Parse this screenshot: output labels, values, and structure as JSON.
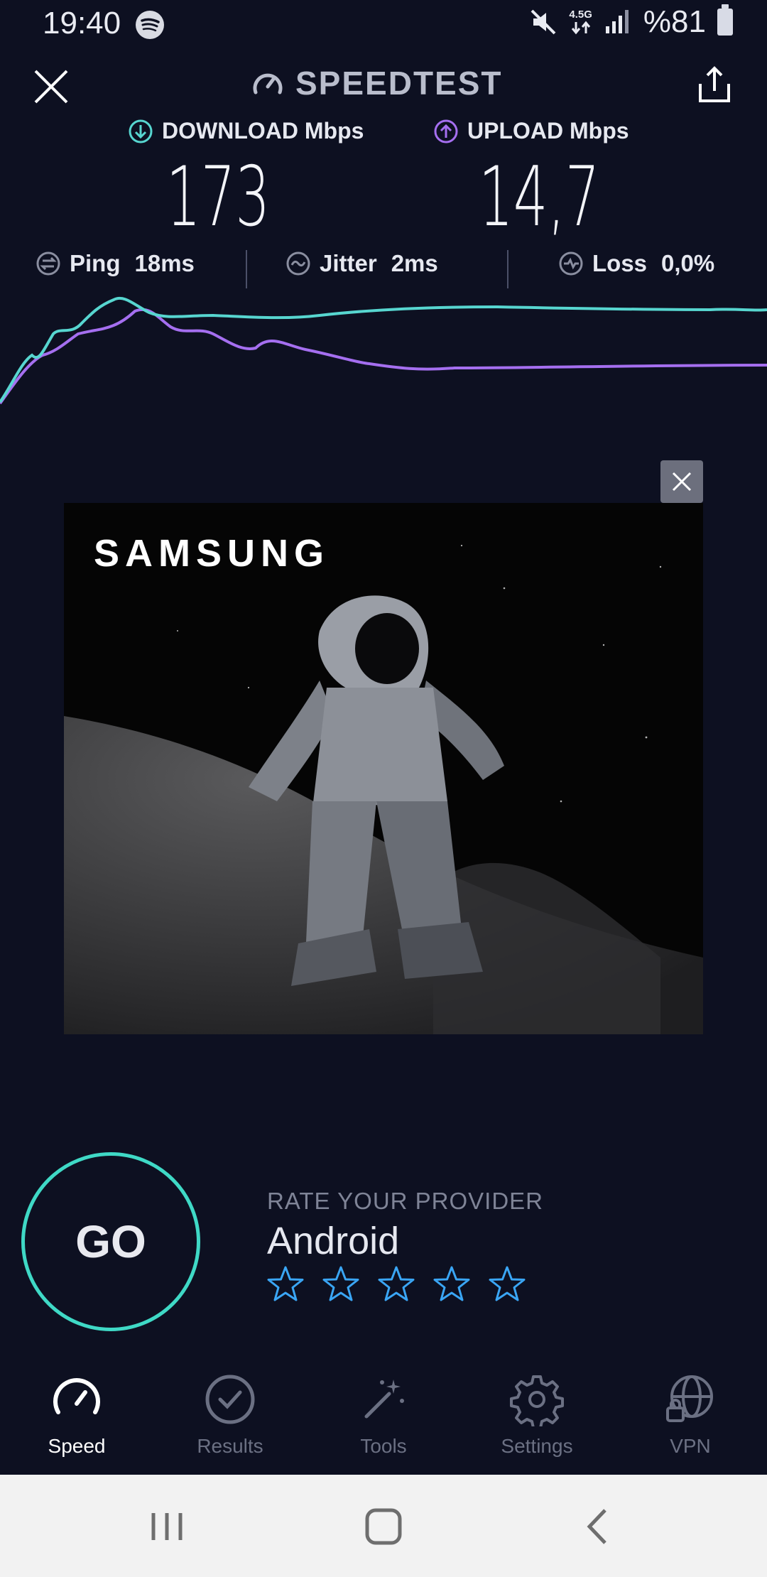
{
  "status_bar": {
    "time": "19:40",
    "network": "4.5G",
    "battery": "%81",
    "icons": [
      "spotify-icon",
      "mute-icon",
      "data-arrows-icon",
      "signal-icon",
      "battery-icon"
    ]
  },
  "header": {
    "title": "SPEEDTEST",
    "icons": [
      "close-icon",
      "speedometer-icon",
      "share-icon"
    ]
  },
  "metrics": {
    "download_label": "DOWNLOAD Mbps",
    "download_value": "173",
    "upload_label": "UPLOAD Mbps",
    "upload_value": "14,7"
  },
  "stats": {
    "ping_label": "Ping",
    "ping_value": "18ms",
    "jitter_label": "Jitter",
    "jitter_value": "2ms",
    "loss_label": "Loss",
    "loss_value": "0,0%"
  },
  "colors": {
    "background": "#0d1021",
    "download": "#57d6d0",
    "upload": "#a56ff0",
    "accent_go": "#3fd9c6",
    "stars": "#3aa6f5"
  },
  "ad": {
    "brand": "SAMSUNG",
    "close_icon": "close-icon"
  },
  "rating": {
    "prompt": "RATE YOUR PROVIDER",
    "provider": "Android",
    "stars_count": 5
  },
  "go_label": "GO",
  "nav": [
    {
      "label": "Speed",
      "icon": "speedometer-icon",
      "active": true
    },
    {
      "label": "Results",
      "icon": "check-circle-icon",
      "active": false
    },
    {
      "label": "Tools",
      "icon": "magic-wand-icon",
      "active": false
    },
    {
      "label": "Settings",
      "icon": "gear-icon",
      "active": false
    },
    {
      "label": "VPN",
      "icon": "globe-lock-icon",
      "active": false
    }
  ],
  "system_nav": [
    "recents-icon",
    "home-icon",
    "back-icon"
  ]
}
